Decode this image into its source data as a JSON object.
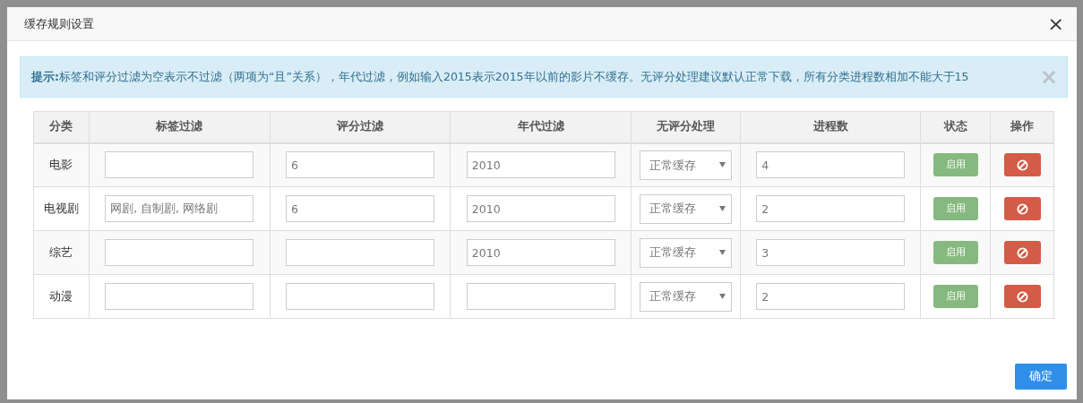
{
  "dialog": {
    "title": "缓存规则设置",
    "close": "×"
  },
  "alert": {
    "label": "提示:",
    "text": "标签和评分过滤为空表示不过滤（两项为“且”关系），年代过滤，例如输入2015表示2015年以前的影片不缓存。无评分处理建议默认正常下载，所有分类进程数相加不能大于15",
    "close": "×"
  },
  "table": {
    "columns": [
      "分类",
      "标签过滤",
      "评分过滤",
      "年代过滤",
      "无评分处理",
      "进程数",
      "状态",
      "操作"
    ],
    "rows": [
      {
        "category": "电影",
        "tags": "",
        "score": "6",
        "year": "2010",
        "no_score": "正常缓存",
        "threads": "4",
        "status": "启用"
      },
      {
        "category": "电视剧",
        "tags": "网剧, 自制剧, 网络剧",
        "score": "6",
        "year": "2010",
        "no_score": "正常缓存",
        "threads": "2",
        "status": "启用"
      },
      {
        "category": "综艺",
        "tags": "",
        "score": "",
        "year": "2010",
        "no_score": "正常缓存",
        "threads": "3",
        "status": "启用"
      },
      {
        "category": "动漫",
        "tags": "",
        "score": "",
        "year": "",
        "no_score": "正常缓存",
        "threads": "2",
        "status": "启用"
      }
    ]
  },
  "footer": {
    "confirm": "确定"
  }
}
